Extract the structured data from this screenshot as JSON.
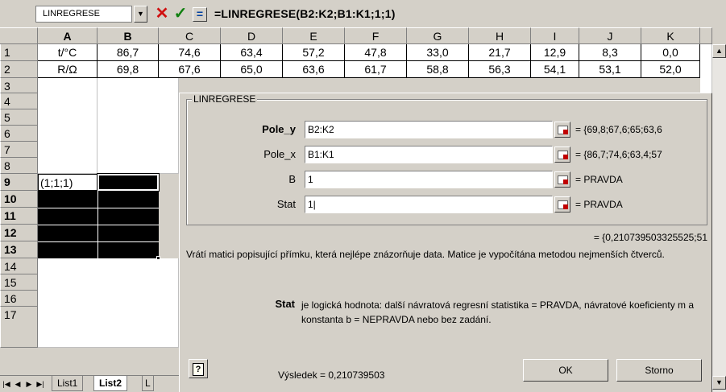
{
  "formula_bar": {
    "name_box": "LINREGRESE",
    "cancel_symbol": "✕",
    "enter_symbol": "✓",
    "edit_symbol": "=",
    "formula": "=LINREGRESE(B2:K2;B1:K1;1;1)"
  },
  "columns": [
    "A",
    "B",
    "C",
    "D",
    "E",
    "F",
    "G",
    "H",
    "I",
    "J",
    "K"
  ],
  "rows": [
    "1",
    "2",
    "3",
    "4",
    "5",
    "6",
    "7",
    "8",
    "9",
    "10",
    "11",
    "12",
    "13",
    "14",
    "15",
    "16",
    "17"
  ],
  "data_rows": [
    [
      "t/°C",
      "86,7",
      "74,6",
      "63,4",
      "57,2",
      "47,8",
      "33,0",
      "21,7",
      "12,9",
      "8,3",
      "0,0"
    ],
    [
      "R/Ω",
      "69,8",
      "67,6",
      "65,0",
      "63,6",
      "61,7",
      "58,8",
      "56,3",
      "54,1",
      "53,1",
      "52,0"
    ]
  ],
  "editing_cell_text": "(1;1;1)",
  "sheet_tabs": [
    "List1",
    "List2",
    "L"
  ],
  "dialog": {
    "group_title": "LINREGRESE",
    "args": [
      {
        "label": "Pole_y",
        "value": "B2:K2",
        "result": "= {69,8;67,6;65;63,6"
      },
      {
        "label": "Pole_x",
        "value": "B1:K1",
        "result": "= {86,7;74,6;63,4;57"
      },
      {
        "label": "B",
        "value": "1",
        "result": "= PRAVDA"
      },
      {
        "label": "Stat",
        "value": "1|",
        "result": "= PRAVDA"
      }
    ],
    "formula_result": "= {0,210739503325525;51",
    "description": "Vrátí matici popisující přímku, která nejlépe znázorňuje data. Matice je vypočítána metodou nejmenších čtverců.",
    "arg_name": "Stat",
    "arg_desc": "je logická hodnota: další návratová regresní statistika = PRAVDA, návratové koeficienty m a konstanta b = NEPRAVDA nebo bez zadání.",
    "help_label": "?",
    "result_label": "Výsledek = 0,210739503",
    "ok_label": "OK",
    "cancel_label": "Storno"
  }
}
